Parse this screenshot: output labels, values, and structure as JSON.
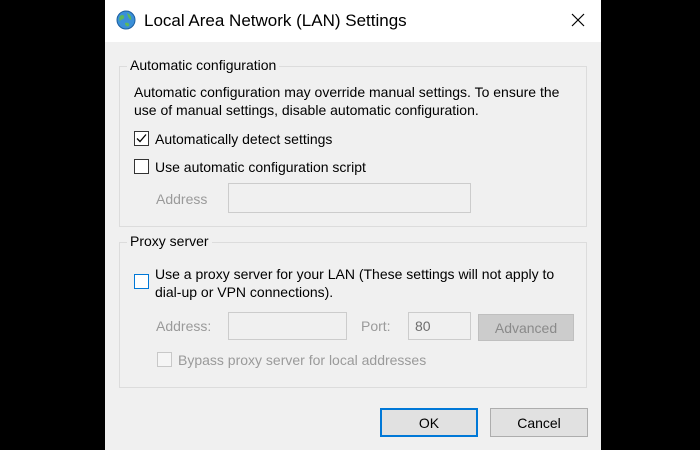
{
  "window": {
    "title": "Local Area Network (LAN) Settings",
    "icon": "globe-network-icon",
    "close_icon": "close-icon"
  },
  "automatic_configuration": {
    "legend": "Automatic configuration",
    "description": "Automatic configuration may override manual settings.  To ensure the use of manual settings, disable automatic configuration.",
    "detect_settings": {
      "label": "Automatically detect settings",
      "checked": true
    },
    "config_script": {
      "label": "Use automatic configuration script",
      "checked": false
    },
    "address_label": "Address",
    "address_value": ""
  },
  "proxy_server": {
    "legend": "Proxy server",
    "use_proxy": {
      "label": "Use a proxy server for your LAN (These settings will not apply to dial-up or VPN connections).",
      "checked": false
    },
    "address_label": "Address:",
    "address_value": "",
    "port_label": "Port:",
    "port_value": "80",
    "advanced_label": "Advanced",
    "bypass": {
      "label": "Bypass proxy server for local addresses",
      "checked": false
    }
  },
  "buttons": {
    "ok_label": "OK",
    "cancel_label": "Cancel"
  },
  "colors": {
    "accent": "#0078d7",
    "dialog_bg": "#f0f0f0",
    "titlebar_bg": "#ffffff",
    "disabled_text": "#9a9a9a"
  }
}
